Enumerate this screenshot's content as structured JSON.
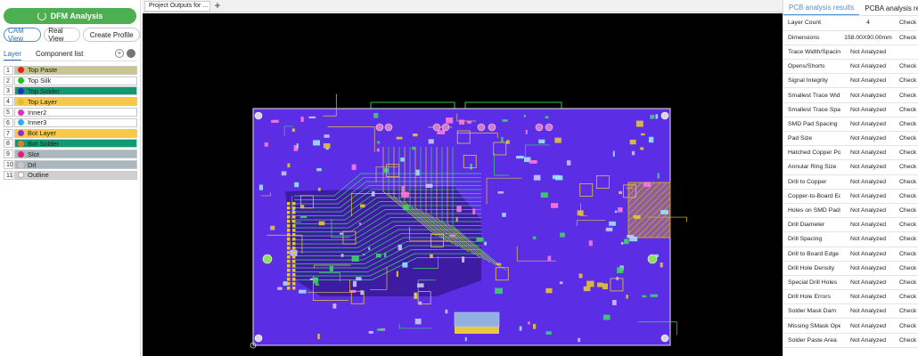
{
  "left": {
    "dfm_label": "DFM Analysis",
    "views": [
      "CAM View",
      "Real View"
    ],
    "create_profile": "Create Profile",
    "tabs": [
      "Layer",
      "Component list"
    ],
    "layers": [
      {
        "num": "1",
        "name": "Top Paste",
        "bg": "#c8c58e",
        "dot": "#e02020"
      },
      {
        "num": "2",
        "name": "Top Silk",
        "bg": "#ffffff",
        "dot": "#20c020"
      },
      {
        "num": "3",
        "name": "Top Solder",
        "bg": "#0f9a72",
        "dot": "#2030c0"
      },
      {
        "num": "4",
        "name": "Top Layer",
        "bg": "#f7c84a",
        "dot": "#e0c020"
      },
      {
        "num": "5",
        "name": "Inner2",
        "bg": "#ffffff",
        "dot": "#e030c0"
      },
      {
        "num": "6",
        "name": "Inner3",
        "bg": "#ffffff",
        "dot": "#30b0e0"
      },
      {
        "num": "7",
        "name": "Bot Layer",
        "bg": "#f7c84a",
        "dot": "#9030c0"
      },
      {
        "num": "8",
        "name": "Bot Solder",
        "bg": "#0f9a72",
        "dot": "#e08020"
      },
      {
        "num": "9",
        "name": "Slot",
        "bg": "#a9b8c0",
        "dot": "#e02070"
      },
      {
        "num": "10",
        "name": "Drl",
        "bg": "#a9b8c0",
        "dot": "#c8c8c8"
      },
      {
        "num": "11",
        "name": "Outline",
        "bg": "#d0d0d0",
        "dot": "#ffffff"
      }
    ]
  },
  "canvas": {
    "tab_label": "Project Outputs for ...",
    "add_tab": "+"
  },
  "right": {
    "tabs": [
      "PCB analysis results",
      "PCBA analysis results"
    ],
    "rows": [
      {
        "name": "Layer Count",
        "value": "4",
        "action": "Check"
      },
      {
        "name": "Dimensions",
        "value": "158.00X90.00mm",
        "action": "Check"
      },
      {
        "name": "Trace Width/Spacing",
        "value": "Not Analyzed",
        "action": ""
      },
      {
        "name": "Opens/Shorts",
        "value": "Not Analyzed",
        "action": "Check"
      },
      {
        "name": "Signal Integrity",
        "value": "Not Analyzed",
        "action": "Check"
      },
      {
        "name": "Smallest Trace Width",
        "value": "Not Analyzed",
        "action": "Check"
      },
      {
        "name": "Smallest Trace Spacing",
        "value": "Not Analyzed",
        "action": "Check"
      },
      {
        "name": "SMD Pad Spacing",
        "value": "Not Analyzed",
        "action": "Check"
      },
      {
        "name": "Pad Size",
        "value": "Not Analyzed",
        "action": "Check"
      },
      {
        "name": "Hatched Copper Pour",
        "value": "Not Analyzed",
        "action": "Check"
      },
      {
        "name": "Annular Ring Size",
        "value": "Not Analyzed",
        "action": "Check"
      },
      {
        "name": "Drill to Copper",
        "value": "Not Analyzed",
        "action": "Check"
      },
      {
        "name": "Copper-to-Board Edge",
        "value": "Not Analyzed",
        "action": "Check"
      },
      {
        "name": "Holes on SMD Pads",
        "value": "Not Analyzed",
        "action": "Check"
      },
      {
        "name": "Drill Diameter",
        "value": "Not Analyzed",
        "action": "Check"
      },
      {
        "name": "Drill Spacing",
        "value": "Not Analyzed",
        "action": "Check"
      },
      {
        "name": "Drill to Board Edge",
        "value": "Not Analyzed",
        "action": "Check"
      },
      {
        "name": "Drill Hole Density",
        "value": "Not Analyzed",
        "action": "Check"
      },
      {
        "name": "Special Drill Holes",
        "value": "Not Analyzed",
        "action": "Check"
      },
      {
        "name": "Drill Hole Errors",
        "value": "Not Analyzed",
        "action": "Check"
      },
      {
        "name": "Solder Mask Dam",
        "value": "Not Analyzed",
        "action": "Check"
      },
      {
        "name": "Missing SMask Opening",
        "value": "Not Analyzed",
        "action": "Check"
      },
      {
        "name": "Solder Paste Area",
        "value": "Not Analyzed",
        "action": "Check"
      }
    ]
  },
  "colors": {
    "accent_green": "#4caf50",
    "board_fill": "#5b2ee6",
    "canvas_bg": "#000000",
    "tab_blue": "#4a90d9"
  }
}
